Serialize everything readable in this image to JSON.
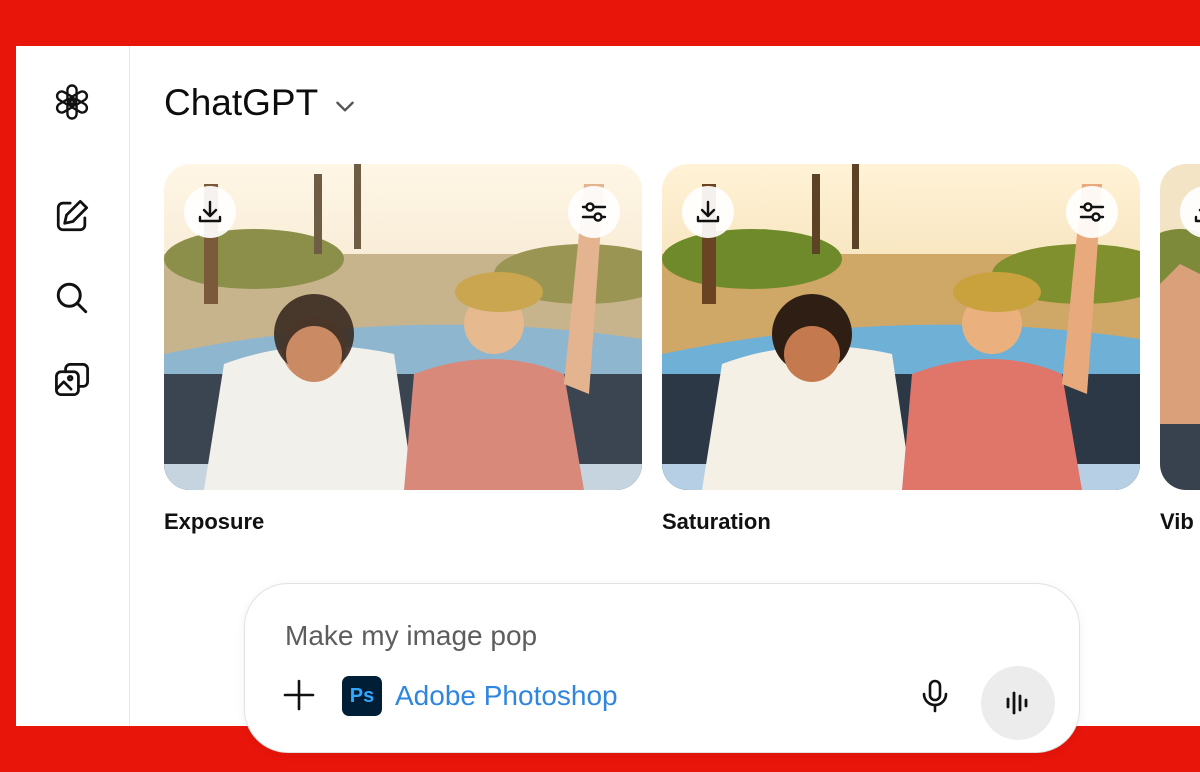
{
  "app": {
    "title": "ChatGPT",
    "brand_color": "#e8150b"
  },
  "sidebar": {
    "items": [
      {
        "icon": "openai-logo-icon"
      },
      {
        "icon": "new-chat-icon"
      },
      {
        "icon": "search-icon"
      },
      {
        "icon": "library-icon"
      }
    ]
  },
  "cards": [
    {
      "label": "Exposure",
      "download_icon": "download-icon",
      "adjust_icon": "sliders-icon"
    },
    {
      "label": "Saturation",
      "download_icon": "download-icon",
      "adjust_icon": "sliders-icon"
    },
    {
      "label": "Vib",
      "download_icon": "download-icon"
    }
  ],
  "composer": {
    "prompt_text": "Make my image pop",
    "app_badge": "Ps",
    "app_name": "Adobe Photoshop",
    "app_name_color": "#2f86df"
  }
}
